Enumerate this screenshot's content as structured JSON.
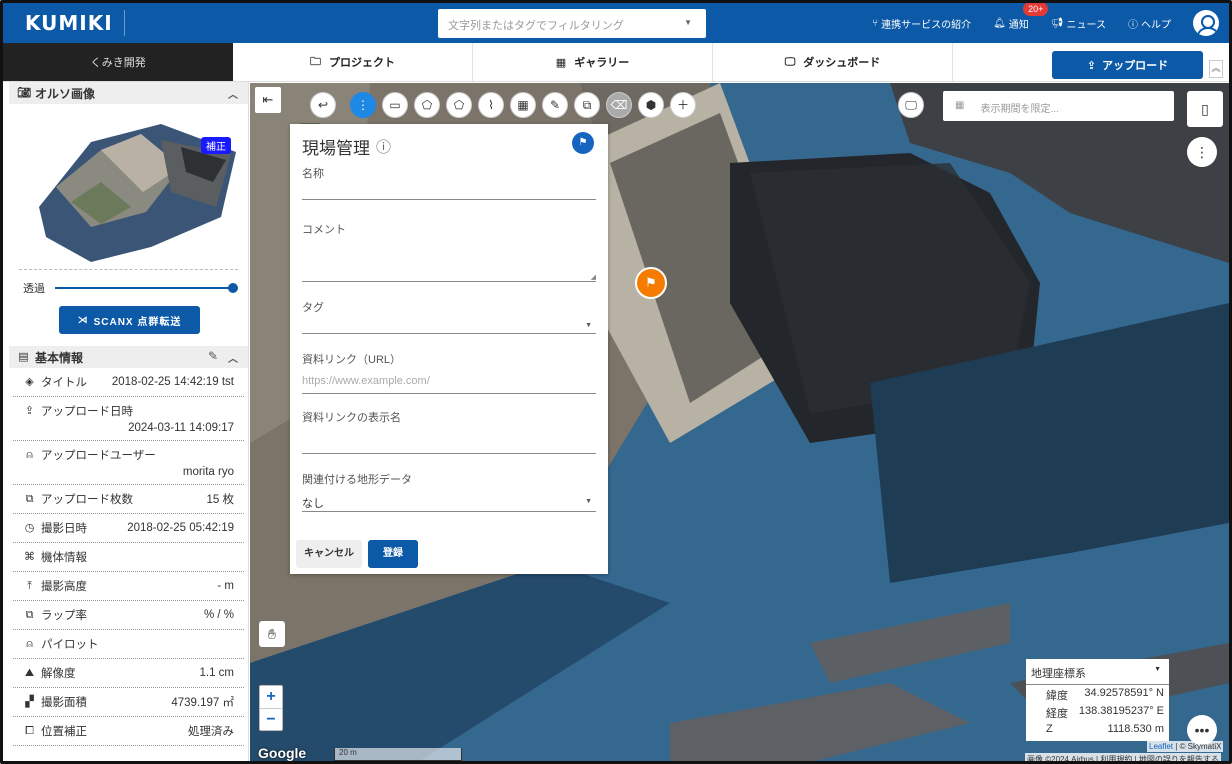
{
  "header": {
    "logo": "KUMIKI",
    "search_placeholder": "文字列またはタグでフィルタリング",
    "nav": {
      "services": "連携サービスの紹介",
      "notifications": "通知",
      "notification_count": "20+",
      "news": "ニュース",
      "help": "ヘルプ"
    }
  },
  "tabs": {
    "project_name": "くみき開発",
    "items": [
      "プロジェクト",
      "ギャラリー",
      "ダッシュボード"
    ],
    "upload": "アップロード"
  },
  "sidebar": {
    "ortho_title": "オルソ画像",
    "correction_badge": "補正",
    "opacity_label": "透過",
    "opacity_value": 1.0,
    "scanx_button": "SCANX 点群転送",
    "basic_info_title": "基本情報",
    "rows": [
      {
        "label": "タイトル",
        "value": "2018-02-25 14:42:19 tst",
        "icon": "layers-icon"
      },
      {
        "label": "アップロード日時",
        "value": "2024-03-11 14:09:17",
        "icon": "upload-icon"
      },
      {
        "label": "アップロードユーザー",
        "value": "morita ryo",
        "icon": "person-icon"
      },
      {
        "label": "アップロード枚数",
        "value": "15 枚",
        "icon": "images-icon"
      },
      {
        "label": "撮影日時",
        "value": "2018-02-25 05:42:19",
        "icon": "clock-icon"
      },
      {
        "label": "機体情報",
        "value": "",
        "icon": "drone-icon"
      },
      {
        "label": "撮影高度",
        "value": "- m",
        "icon": "altitude-icon"
      },
      {
        "label": "ラップ率",
        "value": "% / %",
        "icon": "overlap-icon"
      },
      {
        "label": "パイロット",
        "value": "",
        "icon": "pilot-icon"
      },
      {
        "label": "解像度",
        "value": "1.1 cm",
        "icon": "resolution-icon"
      },
      {
        "label": "撮影面積",
        "value": "4739.197 ㎡",
        "icon": "area-icon"
      },
      {
        "label": "位置補正",
        "value": "処理済み",
        "icon": "position-icon"
      }
    ]
  },
  "map": {
    "period_placeholder": "表示期間を限定...",
    "google": "Google",
    "scale": "20 m",
    "attribution_leaflet": "Leaflet",
    "attribution_skymatix": "© SkymatiX",
    "attribution_imagery": "画像 ©2024 Airbus",
    "attribution_terms": "利用規約",
    "attribution_report": "地図の誤りを報告する"
  },
  "form": {
    "title": "現場管理",
    "name_label": "名称",
    "name_value": "",
    "comment_label": "コメント",
    "comment_value": "",
    "tag_label": "タグ",
    "link_label": "資料リンク（URL）",
    "link_placeholder": "https://www.example.com/",
    "link_display_label": "資料リンクの表示名",
    "link_display_value": "",
    "terrain_label": "関連付ける地形データ",
    "terrain_value": "なし",
    "cancel": "キャンセル",
    "submit": "登録"
  },
  "coords": {
    "system": "地理座標系",
    "lat_label": "緯度",
    "lat_value": "34.92578591° N",
    "lon_label": "経度",
    "lon_value": "138.38195237° E",
    "z_label": "Z",
    "z_value": "1118.530 m"
  }
}
